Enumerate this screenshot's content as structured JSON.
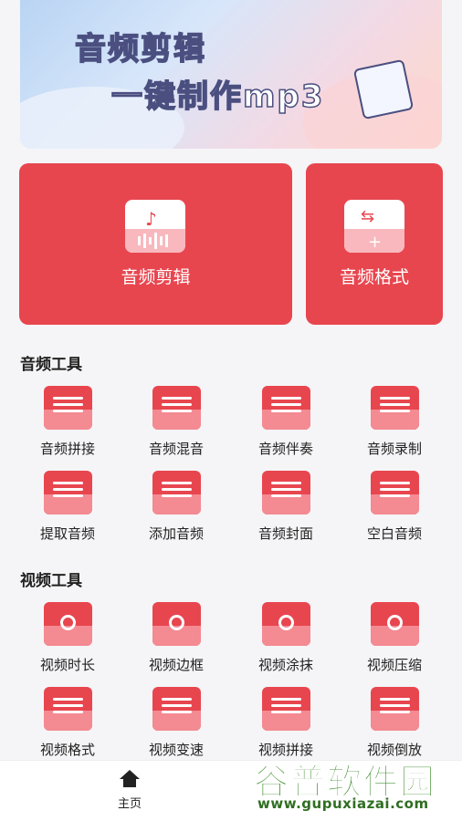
{
  "banner": {
    "line1": "音频剪辑",
    "line2": "一键制作mp3"
  },
  "feature_cards": [
    {
      "label": "音频剪辑",
      "icon": "audio-edit-icon"
    },
    {
      "label": "音频格式",
      "icon": "audio-format-icon"
    }
  ],
  "audio_tools": {
    "title": "音频工具",
    "items": [
      {
        "label": "音频拼接",
        "icon": "folder-list-icon"
      },
      {
        "label": "音频混音",
        "icon": "mixer-icon"
      },
      {
        "label": "音频伴奏",
        "icon": "file-icon"
      },
      {
        "label": "音频录制",
        "icon": "waveform-icon"
      },
      {
        "label": "提取音频",
        "icon": "extract-icon"
      },
      {
        "label": "添加音频",
        "icon": "add-icon"
      },
      {
        "label": "音频封面",
        "icon": "envelope-icon"
      },
      {
        "label": "空白音频",
        "icon": "wallet-icon"
      }
    ]
  },
  "video_tools": {
    "title": "视频工具",
    "items": [
      {
        "label": "视频时长",
        "icon": "clock-icon"
      },
      {
        "label": "视频边框",
        "icon": "clapper-icon"
      },
      {
        "label": "视频涂抹",
        "icon": "folder-star-icon"
      },
      {
        "label": "视频压缩",
        "icon": "compress-icon"
      },
      {
        "label": "视频格式",
        "icon": "document-icon"
      },
      {
        "label": "视频变速",
        "icon": "speed-folder-icon"
      },
      {
        "label": "视频拼接",
        "icon": "plus-stack-icon"
      },
      {
        "label": "视频倒放",
        "icon": "reverse-icon"
      }
    ]
  },
  "bottom_nav": {
    "home_label": "主页"
  },
  "watermark": {
    "brand": "谷普软件园",
    "url": "www.gupuxiazai.com"
  },
  "colors": {
    "accent": "#e8464f",
    "accent_light": "#f48a92",
    "background": "#f5f5f7"
  }
}
